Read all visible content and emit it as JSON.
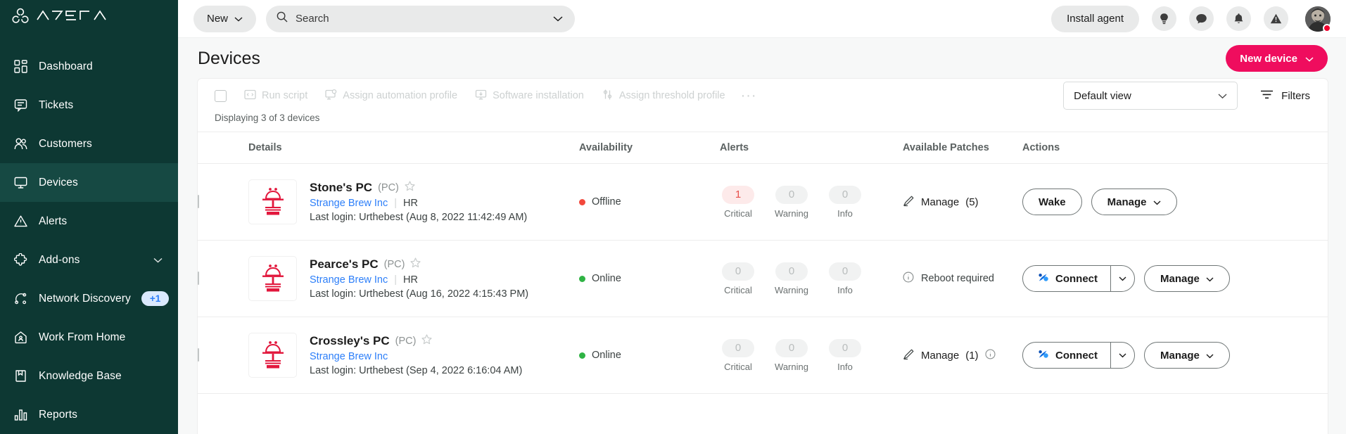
{
  "brand": {
    "name": "ATERA",
    "accent": "#ef0d5e",
    "sidebar_bg": "#0d3833"
  },
  "sidebar": {
    "items": [
      {
        "label": "Dashboard",
        "icon": "dashboard-icon",
        "active": false
      },
      {
        "label": "Tickets",
        "icon": "ticket-icon",
        "active": false
      },
      {
        "label": "Customers",
        "icon": "customers-icon",
        "active": false
      },
      {
        "label": "Devices",
        "icon": "devices-icon",
        "active": true
      },
      {
        "label": "Alerts",
        "icon": "alert-triangle-icon",
        "active": false
      },
      {
        "label": "Add-ons",
        "icon": "puzzle-icon",
        "active": false,
        "chevron": true
      },
      {
        "label": "Network Discovery",
        "icon": "network-icon",
        "active": false,
        "badge": "+1"
      },
      {
        "label": "Work From Home",
        "icon": "home-icon",
        "active": false
      },
      {
        "label": "Knowledge Base",
        "icon": "book-icon",
        "active": false
      },
      {
        "label": "Reports",
        "icon": "bar-chart-icon",
        "active": false
      }
    ]
  },
  "topbar": {
    "new_label": "New",
    "search_placeholder": "Search",
    "install_agent_label": "Install agent",
    "icons": [
      "lightbulb-icon",
      "chat-icon",
      "bell-icon",
      "warning-icon"
    ]
  },
  "page": {
    "title": "Devices",
    "new_device_label": "New device"
  },
  "toolbar": {
    "bulk_actions": [
      {
        "label": "Run script",
        "icon": "code-icon"
      },
      {
        "label": "Assign automation profile",
        "icon": "automation-icon"
      },
      {
        "label": "Software installation",
        "icon": "download-icon"
      },
      {
        "label": "Assign threshold profile",
        "icon": "sliders-icon"
      }
    ],
    "overflow_label": "···",
    "view_selected": "Default view",
    "filters_label": "Filters"
  },
  "table": {
    "count_text": "Displaying 3 of 3 devices",
    "columns": [
      "",
      "Details",
      "Availability",
      "Alerts",
      "Available Patches",
      "Actions"
    ],
    "alert_labels": [
      "Critical",
      "Warning",
      "Info"
    ],
    "rows": [
      {
        "name": "Stone's PC",
        "type": "(PC)",
        "customer": "Strange Brew Inc",
        "department": "HR",
        "last_login": "Last login: Urthebest (Aug 8, 2022 11:42:49 AM)",
        "availability": "Offline",
        "availability_state": "offline",
        "alerts": {
          "critical": "1",
          "warning": "0",
          "info": "0"
        },
        "patches": {
          "kind": "manage",
          "label": "Manage",
          "count": "(5)",
          "has_info": false
        },
        "actions": {
          "kind": "wake",
          "primary": "Wake",
          "manage": "Manage"
        }
      },
      {
        "name": "Pearce's PC",
        "type": "(PC)",
        "customer": "Strange Brew Inc",
        "department": "HR",
        "last_login": "Last login: Urthebest (Aug 16, 2022 4:15:43 PM)",
        "availability": "Online",
        "availability_state": "online",
        "alerts": {
          "critical": "0",
          "warning": "0",
          "info": "0"
        },
        "patches": {
          "kind": "reboot",
          "label": "Reboot required",
          "count": "",
          "has_info": false
        },
        "actions": {
          "kind": "connect",
          "primary": "Connect",
          "manage": "Manage"
        }
      },
      {
        "name": "Crossley's PC",
        "type": "(PC)",
        "customer": "Strange Brew Inc",
        "department": "",
        "last_login": "Last login: Urthebest (Sep 4, 2022 6:16:04 AM)",
        "availability": "Online",
        "availability_state": "online",
        "alerts": {
          "critical": "0",
          "warning": "0",
          "info": "0"
        },
        "patches": {
          "kind": "manage",
          "label": "Manage",
          "count": "(1)",
          "has_info": true
        },
        "actions": {
          "kind": "connect",
          "primary": "Connect",
          "manage": "Manage"
        }
      }
    ]
  }
}
